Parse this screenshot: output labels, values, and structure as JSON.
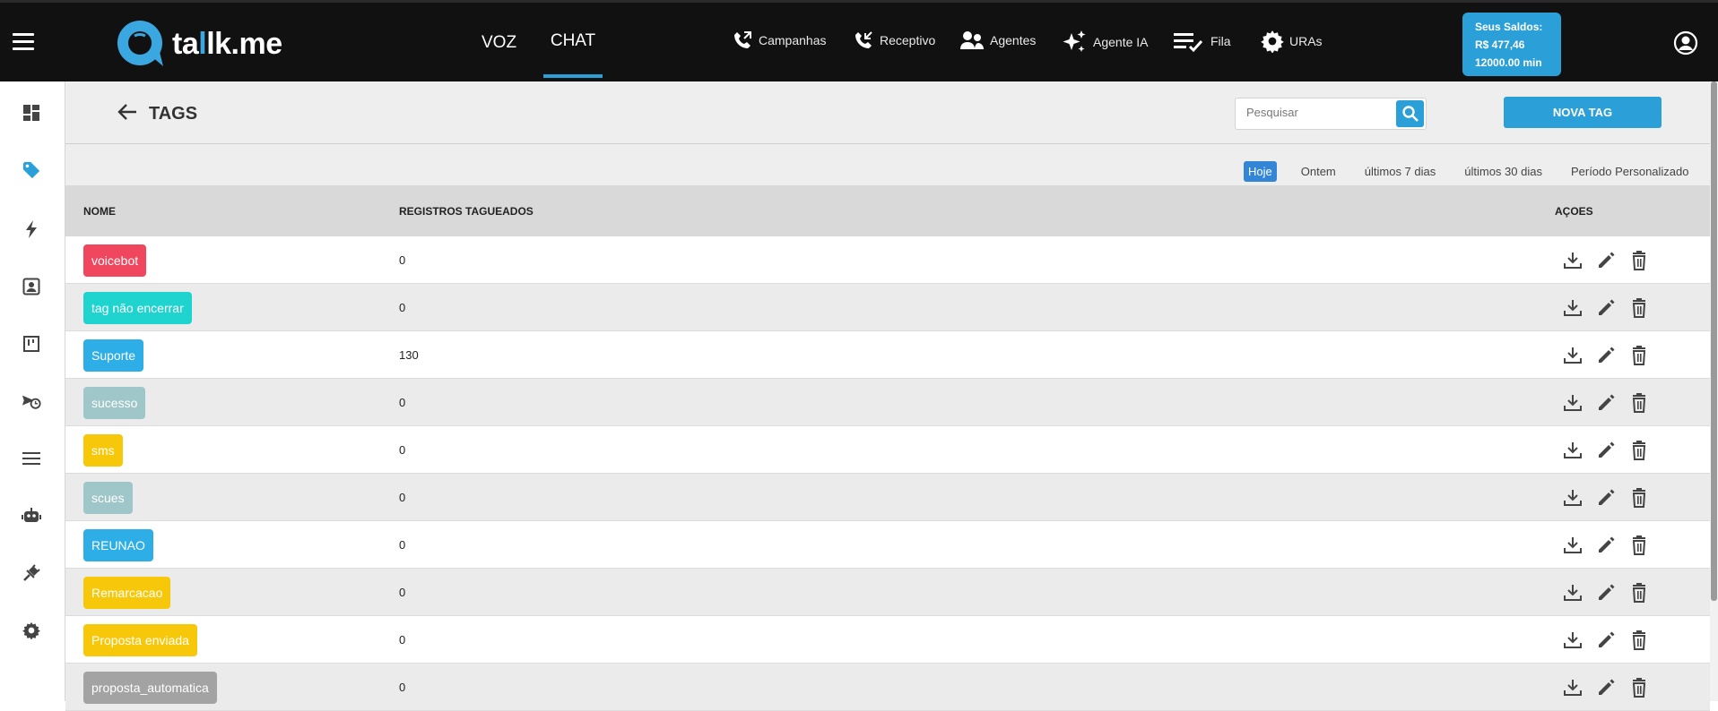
{
  "app": {
    "logo_prefix": "ta",
    "logo_accent": "l",
    "logo_suffix": "lk.me",
    "brand_color": "#2b9fd8"
  },
  "topnav": {
    "voz": "VOZ",
    "chat": "CHAT",
    "items": [
      {
        "label": "Campanhas",
        "icon": "phone-outgoing-icon"
      },
      {
        "label": "Receptivo",
        "icon": "phone-incoming-icon"
      },
      {
        "label": "Agentes",
        "icon": "agents-icon"
      },
      {
        "label": "Agente IA",
        "icon": "sparkles-icon"
      },
      {
        "label": "Fila",
        "icon": "queue-icon"
      },
      {
        "label": "URAs",
        "icon": "gear-icon"
      }
    ],
    "saldo": {
      "title": "Seus Saldos:",
      "money": "R$ 477,46",
      "minutes": "12000.00 min"
    }
  },
  "sidebar": {
    "items": [
      "dashboard-icon",
      "tag-icon",
      "lightning-icon",
      "contact-icon",
      "kanban-icon",
      "campaign-clock-icon",
      "list-icon",
      "robot-icon",
      "plug-icon",
      "settings-icon"
    ],
    "active": "tag-icon"
  },
  "page": {
    "title": "TAGS",
    "search_placeholder": "Pesquisar",
    "new_tag_label": "NOVA TAG"
  },
  "filters": [
    {
      "label": "Hoje",
      "active": true
    },
    {
      "label": "Ontem",
      "active": false
    },
    {
      "label": "últimos 7 dias",
      "active": false
    },
    {
      "label": "últimos 30 dias",
      "active": false
    },
    {
      "label": "Período Personalizado",
      "active": false
    }
  ],
  "table": {
    "headers": {
      "name": "NOME",
      "count": "REGISTROS TAGUEADOS",
      "actions": "AÇOES"
    },
    "rows": [
      {
        "name": "voicebot",
        "count": "0",
        "color": "#f0475f"
      },
      {
        "name": "tag não encerrar",
        "count": "0",
        "color": "#1fd3cf"
      },
      {
        "name": "Suporte",
        "count": "130",
        "color": "#2eaee6"
      },
      {
        "name": "sucesso",
        "count": "0",
        "color": "#9fc6c8"
      },
      {
        "name": "sms",
        "count": "0",
        "color": "#f7c80a"
      },
      {
        "name": "scues",
        "count": "0",
        "color": "#9fc6c8"
      },
      {
        "name": "REUNAO",
        "count": "0",
        "color": "#2eaee6"
      },
      {
        "name": "Remarcacao",
        "count": "0",
        "color": "#f7c80a"
      },
      {
        "name": "Proposta enviada",
        "count": "0",
        "color": "#f7c80a"
      },
      {
        "name": "proposta_automatica",
        "count": "0",
        "color": "#a3a3a3"
      }
    ]
  }
}
